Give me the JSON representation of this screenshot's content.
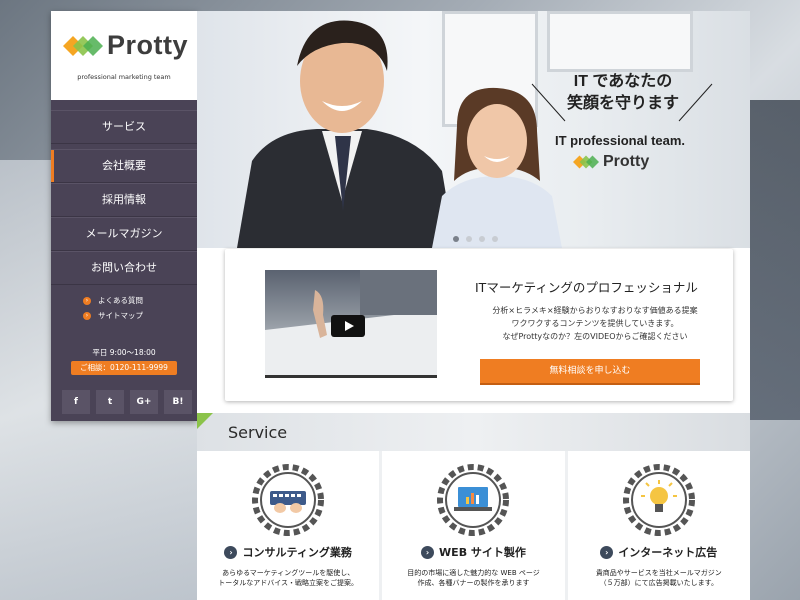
{
  "brand": {
    "name": "Protty",
    "tagline": "professional marketing team"
  },
  "sidebar": {
    "items": [
      {
        "label": "サービス"
      },
      {
        "label": "会社概要"
      },
      {
        "label": "採用情報"
      },
      {
        "label": "メールマガジン"
      },
      {
        "label": "お問い合わせ"
      }
    ],
    "sublinks": [
      {
        "label": "よくある質問"
      },
      {
        "label": "サイトマップ"
      }
    ],
    "hours": "平日 9:00〜18:00",
    "tel": "ご相談：0120-111-9999",
    "socials": [
      {
        "label": "f",
        "icon": "facebook-icon"
      },
      {
        "label": "t",
        "icon": "twitter-icon"
      },
      {
        "label": "G+",
        "icon": "google-plus-icon"
      },
      {
        "label": "B!",
        "icon": "hatena-bookmark-icon"
      }
    ]
  },
  "hero": {
    "line1": "IT であなたの",
    "line2": "笑顔を守ります",
    "line3": "IT professional team.",
    "logo_text": "Protty",
    "slides": 4,
    "active_slide": 1
  },
  "promo": {
    "title": "ITマーケティングのプロフェッショナル",
    "text_lines": [
      "分析×ヒラメキ×経験からおりなすおりなす価値ある提案",
      "ワクワクするコンテンツを提供していきます。",
      "なぜProttyなのか？左のVIDEOからご確認ください"
    ],
    "cta": "無料相談を申し込む"
  },
  "service": {
    "heading": "Service",
    "cards": [
      {
        "title": "コンサルティング業務",
        "icon": "keyboard-hands-icon",
        "desc": [
          "あらゆるマーケティングツールを駆使し、",
          "トータルなアドバイス・戦略立案をご提案。"
        ]
      },
      {
        "title": "WEB サイト製作",
        "icon": "laptop-chart-icon",
        "desc": [
          "目的の市場に適した魅力的な WEB ページ",
          "作成、各種バナーの製作を承ります"
        ]
      },
      {
        "title": "インターネット広告",
        "icon": "lightbulb-icon",
        "desc": [
          "貴商品やサービスを当社メールマガジン",
          "（５万部）にて広告掲載いたします。"
        ]
      }
    ]
  },
  "colors": {
    "accent": "#ef7d22",
    "sidebar": "#4a4356",
    "green": "#8bc34a"
  }
}
